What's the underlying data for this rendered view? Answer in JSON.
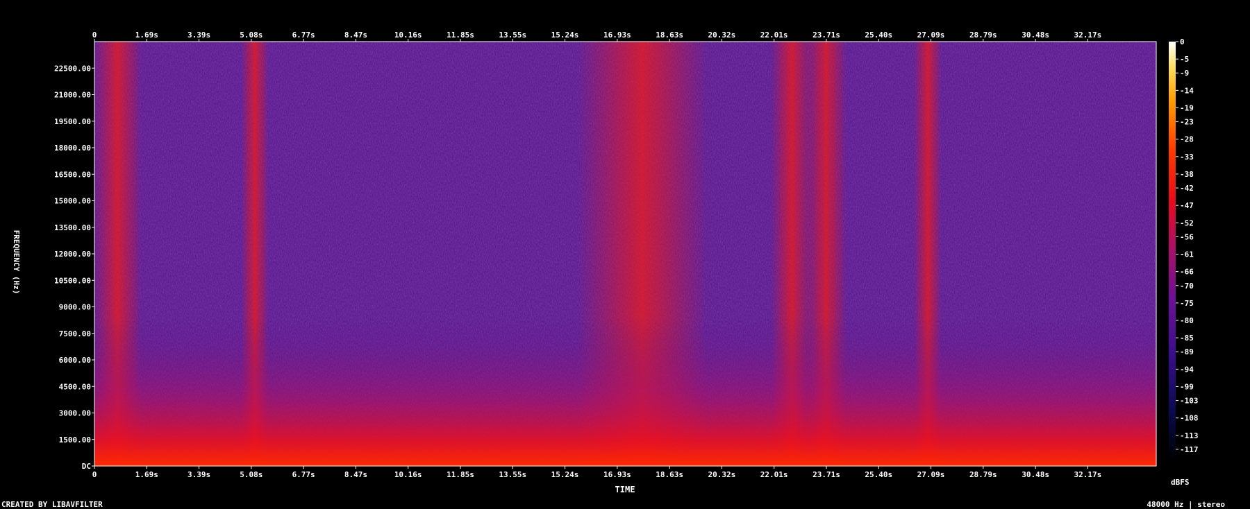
{
  "chart_data": {
    "type": "heatmap",
    "title": "",
    "xlabel": "TIME",
    "ylabel": "FREQUENCY (Hz)",
    "x_ticks": [
      "0",
      "1.69s",
      "3.39s",
      "5.08s",
      "6.77s",
      "8.47s",
      "10.16s",
      "11.85s",
      "13.55s",
      "15.24s",
      "16.93s",
      "18.63s",
      "20.32s",
      "22.01s",
      "23.71s",
      "25.40s",
      "27.09s",
      "28.79s",
      "30.48s",
      "32.17s"
    ],
    "y_ticks": [
      "DC",
      "1500.00",
      "3000.00",
      "4500.00",
      "6000.00",
      "7500.00",
      "9000.00",
      "10500.00",
      "12000.00",
      "13500.00",
      "15000.00",
      "16500.00",
      "18000.00",
      "19500.00",
      "21000.00",
      "22500.00"
    ],
    "xlim_seconds": [
      0,
      34.4
    ],
    "ylim_hz": [
      0,
      24000
    ],
    "colorbar": {
      "unit": "dBFS",
      "ticks": [
        "0",
        "-5",
        "-9",
        "-14",
        "-19",
        "-23",
        "-28",
        "-33",
        "-38",
        "-42",
        "-47",
        "-52",
        "-56",
        "-61",
        "-66",
        "-70",
        "-75",
        "-80",
        "-85",
        "-89",
        "-94",
        "-99",
        "-103",
        "-108",
        "-113",
        "-117"
      ],
      "range_db": [
        -120,
        0
      ]
    },
    "loud_segments_seconds": [
      [
        0.5,
        1.0
      ],
      [
        5.1,
        5.3
      ],
      [
        16.9,
        18.6
      ],
      [
        23.5,
        23.9
      ],
      [
        22.4,
        22.8
      ],
      [
        26.9,
        27.1
      ]
    ],
    "grid": false,
    "legend": "colorbar right"
  },
  "footer": {
    "created_by": "CREATED BY LIBAVFILTER",
    "format": "48000 Hz | stereo"
  },
  "colors": {
    "background": "#000000",
    "axis": "#ffffff"
  }
}
